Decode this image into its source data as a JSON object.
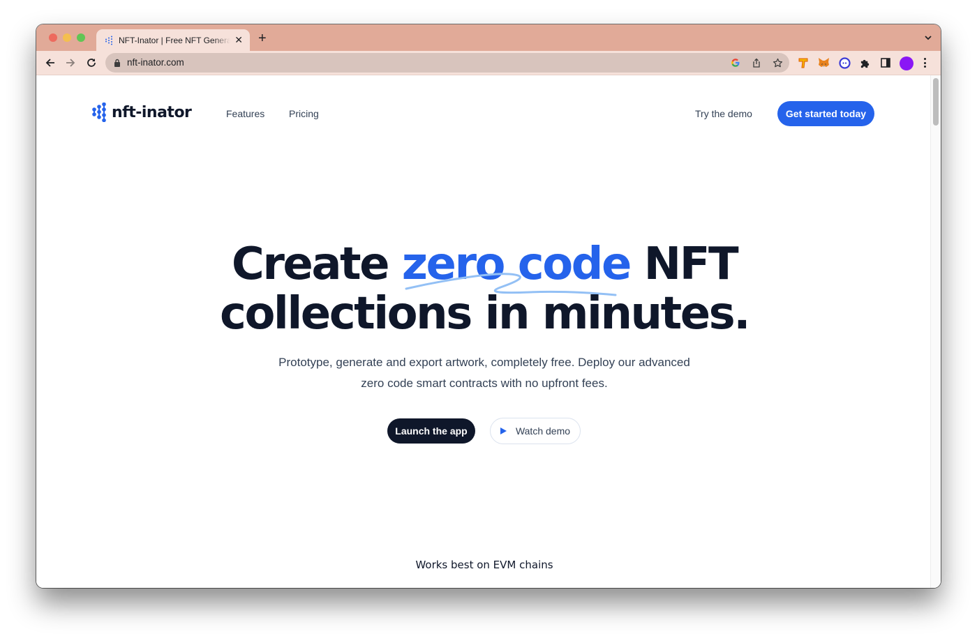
{
  "browser": {
    "tab": {
      "title": "NFT-Inator | Free NFT Generator",
      "favicon": "nft-inator-logo-icon"
    },
    "new_tab_label": "+",
    "url": "nft-inator.com",
    "extensions": [
      "google-icon",
      "share-icon",
      "bookmark-star-icon",
      "token-extension-icon",
      "metamask-fox-icon",
      "ghost-extension-icon",
      "puzzle-extensions-icon",
      "side-panel-icon"
    ],
    "profile_color": "#8a17f5"
  },
  "site": {
    "brand": {
      "name": "nft-inator",
      "color": "#2563eb"
    },
    "nav": [
      {
        "label": "Features"
      },
      {
        "label": "Pricing"
      }
    ],
    "try_demo": "Try the demo",
    "cta": "Get started today",
    "hero": {
      "line1_start": "Create ",
      "line1_accent": "zero code",
      "line1_end": " NFT",
      "line2": "collections in minutes."
    },
    "subtitle_line1": "Prototype, generate and export artwork, completely free. Deploy our advanced",
    "subtitle_line2": "zero code smart contracts with no upfront fees.",
    "launch_button": "Launch the app",
    "watch_button": "Watch demo",
    "evm_text": "Works best on EVM chains"
  },
  "colors": {
    "accent": "#2563eb",
    "dark": "#0f172a",
    "tabstrip": "#e1aa98",
    "toolbar": "#f6e1da"
  }
}
